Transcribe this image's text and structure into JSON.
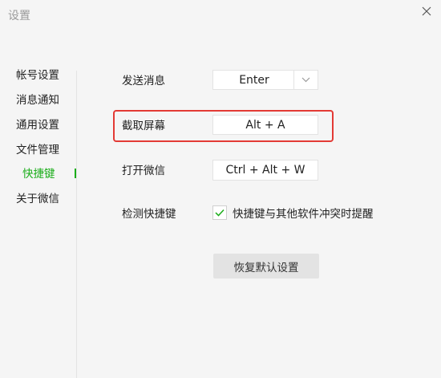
{
  "window": {
    "title": "设置",
    "close_icon": "close-icon"
  },
  "sidebar": {
    "items": [
      {
        "label": "帐号设置",
        "active": false
      },
      {
        "label": "消息通知",
        "active": false
      },
      {
        "label": "通用设置",
        "active": false
      },
      {
        "label": "文件管理",
        "active": false
      },
      {
        "label": "快捷键",
        "active": true
      },
      {
        "label": "关于微信",
        "active": false
      }
    ],
    "active_color": "#1aad19"
  },
  "shortcuts": {
    "send_message": {
      "label": "发送消息",
      "value": "Enter",
      "dropdown_icon": "chevron-down-icon"
    },
    "screenshot": {
      "label": "截取屏幕",
      "value": "Alt + A"
    },
    "open_wechat": {
      "label": "打开微信",
      "value": "Ctrl + Alt + W"
    },
    "detect": {
      "label": "检测快捷键",
      "checkbox_label": "快捷键与其他软件冲突时提醒",
      "checked": true
    }
  },
  "restore_button": {
    "label": "恢复默认设置"
  },
  "highlight_color": "#e33a35"
}
